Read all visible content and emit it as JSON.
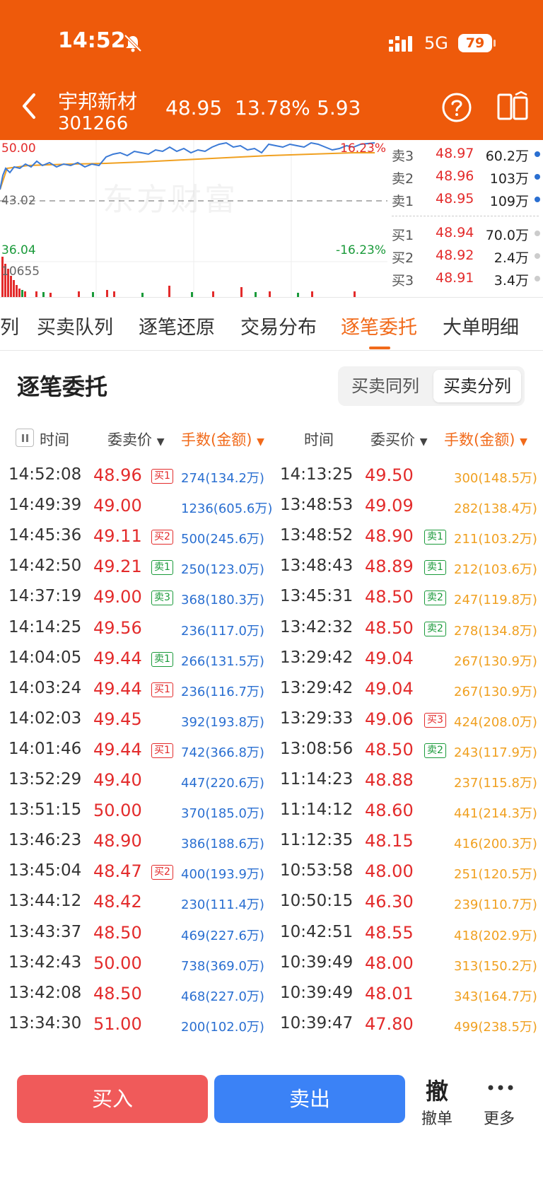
{
  "status": {
    "time": "14:52",
    "network": "5G",
    "battery": "79"
  },
  "stock": {
    "name": "宇邦新材",
    "code": "301266",
    "price": "48.95",
    "pct": "13.78%",
    "change": "5.93"
  },
  "chart": {
    "watermark": "东方财富",
    "high": "50.00",
    "mid": "43.02",
    "low": "36.04",
    "pct_high": "16.23%",
    "pct_low": "-16.23%",
    "volume": "10655"
  },
  "orderbook": {
    "asks": [
      {
        "label": "卖3",
        "price": "48.97",
        "volume": "60.2万"
      },
      {
        "label": "卖2",
        "price": "48.96",
        "volume": "103万"
      },
      {
        "label": "卖1",
        "price": "48.95",
        "volume": "109万"
      }
    ],
    "bids": [
      {
        "label": "买1",
        "price": "48.94",
        "volume": "70.0万"
      },
      {
        "label": "买2",
        "price": "48.92",
        "volume": "2.4万"
      },
      {
        "label": "买3",
        "price": "48.91",
        "volume": "3.4万"
      }
    ]
  },
  "tabs": [
    "列",
    "买卖队列",
    "逐笔还原",
    "交易分布",
    "逐笔委托",
    "大单明细"
  ],
  "section": {
    "title": "逐笔委托",
    "seg_left": "买卖同列",
    "seg_right": "买卖分列"
  },
  "columns": {
    "sell_time": "时间",
    "sell_price": "委卖价",
    "sell_vol": "手数(金额)",
    "buy_time": "时间",
    "buy_price": "委买价",
    "buy_vol": "手数(金额)"
  },
  "rows": [
    {
      "st": "14:52:08",
      "sp": "48.96",
      "sb": "买1",
      "sbc": "red",
      "sv": "274(134.2万)",
      "bt": "14:13:25",
      "bp": "49.50",
      "bb": "",
      "bbc": "",
      "bv": "300(148.5万)"
    },
    {
      "st": "14:49:39",
      "sp": "49.00",
      "sb": "",
      "sbc": "",
      "sv": "1236(605.6万)",
      "bt": "13:48:53",
      "bp": "49.09",
      "bb": "",
      "bbc": "",
      "bv": "282(138.4万)"
    },
    {
      "st": "14:45:36",
      "sp": "49.11",
      "sb": "买2",
      "sbc": "red",
      "sv": "500(245.6万)",
      "bt": "13:48:52",
      "bp": "48.90",
      "bb": "卖1",
      "bbc": "green",
      "bv": "211(103.2万)"
    },
    {
      "st": "14:42:50",
      "sp": "49.21",
      "sb": "卖1",
      "sbc": "green",
      "sv": "250(123.0万)",
      "bt": "13:48:43",
      "bp": "48.89",
      "bb": "卖1",
      "bbc": "green",
      "bv": "212(103.6万)"
    },
    {
      "st": "14:37:19",
      "sp": "49.00",
      "sb": "卖3",
      "sbc": "green",
      "sv": "368(180.3万)",
      "bt": "13:45:31",
      "bp": "48.50",
      "bb": "卖2",
      "bbc": "green",
      "bv": "247(119.8万)"
    },
    {
      "st": "14:14:25",
      "sp": "49.56",
      "sb": "",
      "sbc": "",
      "sv": "236(117.0万)",
      "bt": "13:42:32",
      "bp": "48.50",
      "bb": "卖2",
      "bbc": "green",
      "bv": "278(134.8万)"
    },
    {
      "st": "14:04:05",
      "sp": "49.44",
      "sb": "卖1",
      "sbc": "green",
      "sv": "266(131.5万)",
      "bt": "13:29:42",
      "bp": "49.04",
      "bb": "",
      "bbc": "",
      "bv": "267(130.9万)"
    },
    {
      "st": "14:03:24",
      "sp": "49.44",
      "sb": "买1",
      "sbc": "red",
      "sv": "236(116.7万)",
      "bt": "13:29:42",
      "bp": "49.04",
      "bb": "",
      "bbc": "",
      "bv": "267(130.9万)"
    },
    {
      "st": "14:02:03",
      "sp": "49.45",
      "sb": "",
      "sbc": "",
      "sv": "392(193.8万)",
      "bt": "13:29:33",
      "bp": "49.06",
      "bb": "买3",
      "bbc": "red",
      "bv": "424(208.0万)"
    },
    {
      "st": "14:01:46",
      "sp": "49.44",
      "sb": "买1",
      "sbc": "red",
      "sv": "742(366.8万)",
      "bt": "13:08:56",
      "bp": "48.50",
      "bb": "卖2",
      "bbc": "green",
      "bv": "243(117.9万)"
    },
    {
      "st": "13:52:29",
      "sp": "49.40",
      "sb": "",
      "sbc": "",
      "sv": "447(220.6万)",
      "bt": "11:14:23",
      "bp": "48.88",
      "bb": "",
      "bbc": "",
      "bv": "237(115.8万)"
    },
    {
      "st": "13:51:15",
      "sp": "50.00",
      "sb": "",
      "sbc": "",
      "sv": "370(185.0万)",
      "bt": "11:14:12",
      "bp": "48.60",
      "bb": "",
      "bbc": "",
      "bv": "441(214.3万)"
    },
    {
      "st": "13:46:23",
      "sp": "48.90",
      "sb": "",
      "sbc": "",
      "sv": "386(188.6万)",
      "bt": "11:12:35",
      "bp": "48.15",
      "bb": "",
      "bbc": "",
      "bv": "416(200.3万)"
    },
    {
      "st": "13:45:04",
      "sp": "48.47",
      "sb": "买2",
      "sbc": "red",
      "sv": "400(193.9万)",
      "bt": "10:53:58",
      "bp": "48.00",
      "bb": "",
      "bbc": "",
      "bv": "251(120.5万)"
    },
    {
      "st": "13:44:12",
      "sp": "48.42",
      "sb": "",
      "sbc": "",
      "sv": "230(111.4万)",
      "bt": "10:50:15",
      "bp": "46.30",
      "bb": "",
      "bbc": "",
      "bv": "239(110.7万)"
    },
    {
      "st": "13:43:37",
      "sp": "48.50",
      "sb": "",
      "sbc": "",
      "sv": "469(227.6万)",
      "bt": "10:42:51",
      "bp": "48.55",
      "bb": "",
      "bbc": "",
      "bv": "418(202.9万)"
    },
    {
      "st": "13:42:43",
      "sp": "50.00",
      "sb": "",
      "sbc": "",
      "sv": "738(369.0万)",
      "bt": "10:39:49",
      "bp": "48.00",
      "bb": "",
      "bbc": "",
      "bv": "313(150.2万)"
    },
    {
      "st": "13:42:08",
      "sp": "48.50",
      "sb": "",
      "sbc": "",
      "sv": "468(227.0万)",
      "bt": "10:39:49",
      "bp": "48.01",
      "bb": "",
      "bbc": "",
      "bv": "343(164.7万)"
    },
    {
      "st": "13:34:30",
      "sp": "51.00",
      "sb": "",
      "sbc": "",
      "sv": "200(102.0万)",
      "bt": "10:39:47",
      "bp": "47.80",
      "bb": "",
      "bbc": "",
      "bv": "499(238.5万)"
    }
  ],
  "bottom": {
    "buy": "买入",
    "sell": "卖出",
    "cancel_glyph": "撤",
    "cancel": "撤单",
    "more": "更多"
  },
  "colors": {
    "header": "#EE5A0B",
    "accent": "#F16A1A",
    "up": "#e32b2b",
    "down": "#1a9a3a",
    "sell_vol": "#2a6fd1",
    "buy_vol": "#f0a020"
  }
}
